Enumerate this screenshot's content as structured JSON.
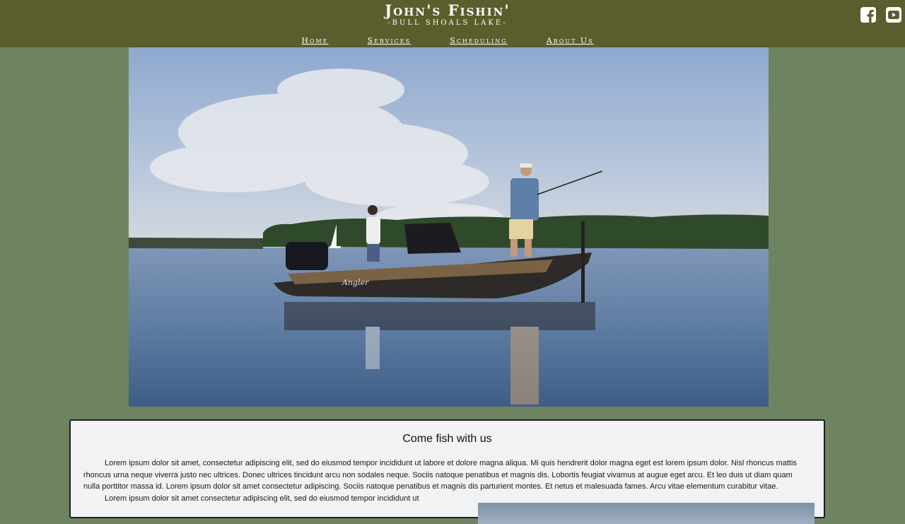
{
  "brand": {
    "title": "John's Fishin'",
    "subtitle": "-BULL SHOALS LAKE-"
  },
  "nav": {
    "items": [
      {
        "label": "Home"
      },
      {
        "label": "Services"
      },
      {
        "label": "Scheduling"
      },
      {
        "label": "About Us"
      }
    ]
  },
  "social": {
    "icons": [
      "facebook-icon",
      "youtube-icon"
    ]
  },
  "hero": {
    "image": "two people fishing from a boat on a lake",
    "boat_text": "Angler"
  },
  "content": {
    "heading": "Come fish with us",
    "paragraph1": "Lorem ipsum dolor sit amet, consectetur adipiscing elit, sed do eiusmod tempor incididunt ut labore et dolore magna aliqua. Mi quis hendrerit dolor magna eget est lorem ipsum dolor. Nisl rhoncus mattis rhoncus urna neque viverra justo nec ultrices. Donec ultrices tincidunt arcu non sodales neque. Sociis natoque penatibus et magnis dis. Lobortis feugiat vivamus at augue eget arcu. Et leo duis ut diam quam nulla porttitor massa id. Lorem ipsum dolor sit amet consectetur adipiscing. Sociis natoque penatibus et magnis dis parturient montes. Et netus et malesuada fames. Arcu vitae elementum curabitur vitae.",
    "paragraph2": "Lorem ipsum dolor sit amet consectetur adipiscing elit, sed do eiusmod tempor incididunt ut"
  },
  "colors": {
    "header": "#5a5e2c",
    "page": "#6e8460",
    "card": "#f0f2f4"
  }
}
